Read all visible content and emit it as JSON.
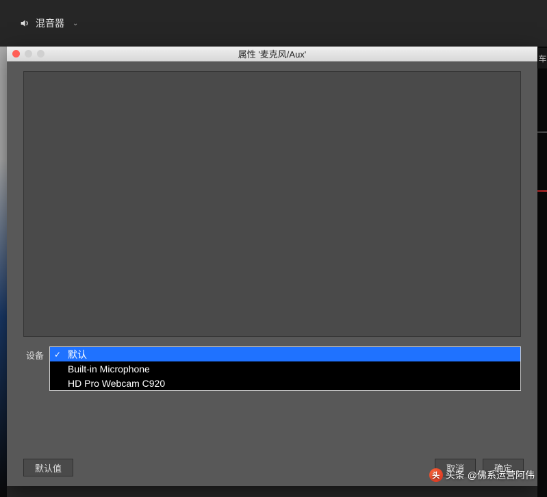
{
  "top_bar": {
    "mixer_label": "混音器"
  },
  "dialog": {
    "title": "属性 '麦克风/Aux'",
    "device_label": "设备",
    "options": [
      {
        "label": "默认",
        "selected": true
      },
      {
        "label": "Built-in Microphone",
        "selected": false
      },
      {
        "label": "HD Pro Webcam C920",
        "selected": false
      }
    ],
    "buttons": {
      "defaults": "默认值",
      "cancel": "取消",
      "ok": "确定"
    }
  },
  "watermark": {
    "logo_char": "头",
    "prefix": "头条",
    "text": "@佛系运营阿伟"
  },
  "side_tab": {
    "char": "车"
  }
}
